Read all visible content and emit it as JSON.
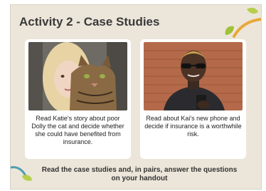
{
  "slide": {
    "title": "Activity 2 - Case Studies",
    "instruction": "Read the case studies and, in pairs, answer the questions on your handout"
  },
  "cards": [
    {
      "caption": "Read Katie's story about poor Dolly the cat and decide whether she could have benefited from insurance."
    },
    {
      "caption": "Read about Kai's new phone and decide if insurance is a worthwhile risk."
    }
  ],
  "colors": {
    "background": "#ece6da",
    "card": "#ffffff",
    "accent_green": "#9fc23a",
    "accent_orange": "#e8a83a",
    "accent_teal": "#4f9db0"
  }
}
